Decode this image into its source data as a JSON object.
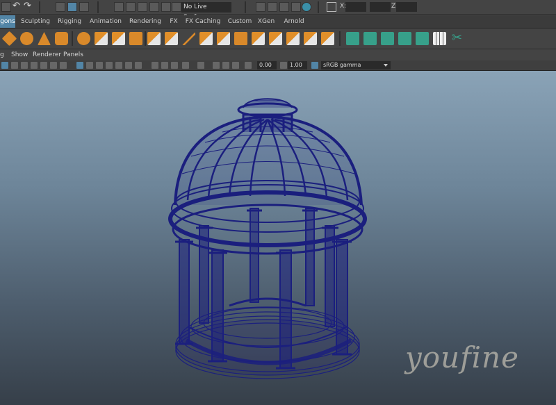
{
  "status_line": {
    "live_surface": "No Live Surface",
    "coord_labels": [
      "X:",
      "Y:",
      "Z:"
    ]
  },
  "shelf_tabs": [
    {
      "label": "gons",
      "active": true
    },
    {
      "label": "Sculpting",
      "active": false
    },
    {
      "label": "Rigging",
      "active": false
    },
    {
      "label": "Animation",
      "active": false
    },
    {
      "label": "Rendering",
      "active": false
    },
    {
      "label": "FX",
      "active": false
    },
    {
      "label": "FX Caching",
      "active": false
    },
    {
      "label": "Custom",
      "active": false
    },
    {
      "label": "XGen",
      "active": false
    },
    {
      "label": "Arnold",
      "active": false
    }
  ],
  "panel_menu": [
    "g",
    "Show",
    "Renderer",
    "Panels"
  ],
  "panel_toolbar": {
    "field_a": "0.00",
    "field_b": "1.00",
    "color_management": "sRGB gamma"
  },
  "viewport": {
    "watermark": "youfine",
    "model": "wireframe gazebo dome"
  },
  "colors": {
    "accent": "#5285a6",
    "wireframe": "#1a1f7a",
    "shelf_orange": "#d9892a",
    "shelf_green": "#37a08a"
  }
}
